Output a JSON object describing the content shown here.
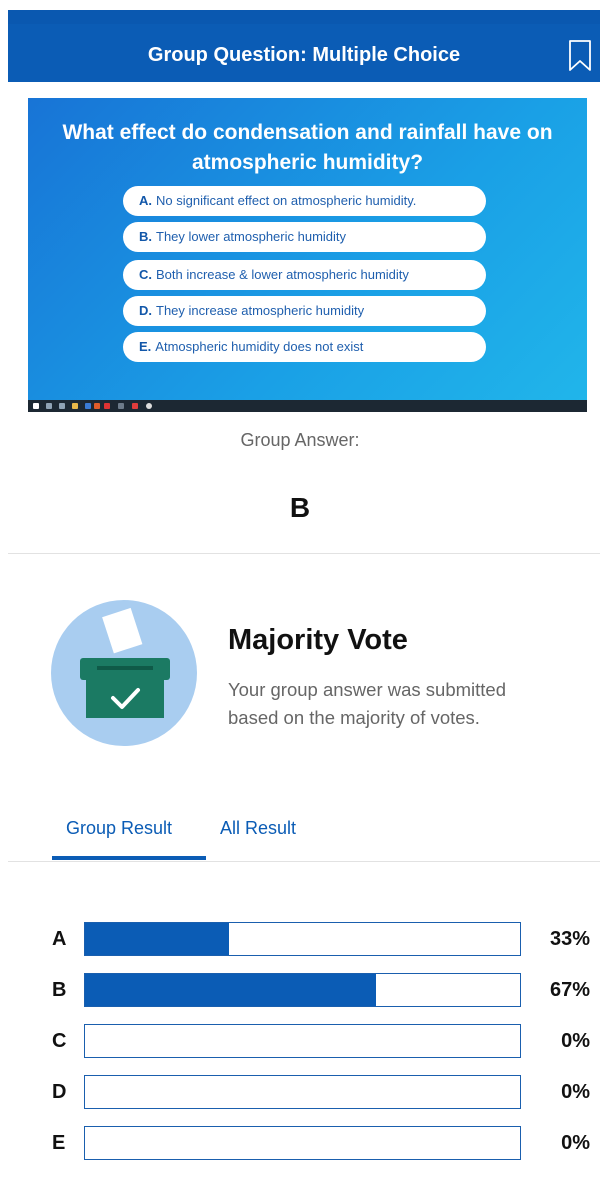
{
  "header": {
    "title": "Group Question: Multiple Choice",
    "bookmark_icon": "bookmark-icon"
  },
  "slide": {
    "question": "What effect do condensation and rainfall have on atmospheric humidity?",
    "options": [
      {
        "letter": "A.",
        "text": "No significant effect on atmospheric humidity."
      },
      {
        "letter": "B.",
        "text": "They lower atmospheric humidity"
      },
      {
        "letter": "C.",
        "text": "Both increase & lower atmospheric humidity"
      },
      {
        "letter": "D.",
        "text": "They increase atmospheric humidity"
      },
      {
        "letter": "E.",
        "text": "Atmospheric humidity does not exist"
      }
    ]
  },
  "group_answer": {
    "label": "Group Answer:",
    "value": "B"
  },
  "majority": {
    "title": "Majority Vote",
    "description": "Your group answer was submitted based on the majority of votes.",
    "icon": "ballot-box-icon"
  },
  "tabs": [
    {
      "label": "Group Result",
      "active": true
    },
    {
      "label": "All Result",
      "active": false
    }
  ],
  "results": [
    {
      "letter": "A",
      "percent_label": "33%",
      "fraction": 0.33
    },
    {
      "letter": "B",
      "percent_label": "67%",
      "fraction": 0.67
    },
    {
      "letter": "C",
      "percent_label": "0%",
      "fraction": 0
    },
    {
      "letter": "D",
      "percent_label": "0%",
      "fraction": 0
    },
    {
      "letter": "E",
      "percent_label": "0%",
      "fraction": 0
    }
  ],
  "colors": {
    "brand": "#0b5cb5",
    "bar_fill": "#0b5cb5",
    "icon_bg": "#a9cdf0",
    "box_green": "#1b7a63"
  }
}
